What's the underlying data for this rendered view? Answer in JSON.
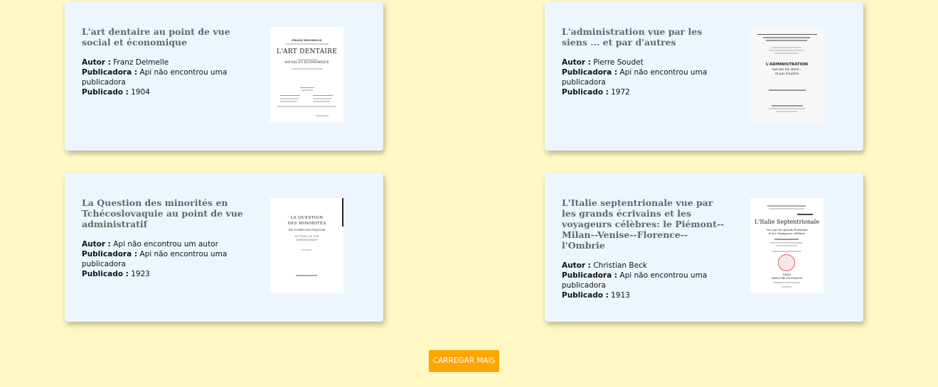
{
  "labels": {
    "author": "Autor :",
    "publisher": "Publicadora :",
    "published": "Publicado :"
  },
  "books": [
    {
      "title": "L'art dentaire au point de vue social et économique",
      "author": "Franz Delmelle",
      "publisher": "Api não encontrou uma publicadora",
      "published": "1904",
      "cover_text": [
        "FRANZ DELMELLE",
        "L'ART DENTAIRE",
        "SOCIAL ET ÉCONOMIQUE"
      ]
    },
    {
      "title": "L'administration vue par les siens ... et par d'autres",
      "author": "Pierre Soudet",
      "publisher": "Api não encontrou uma publicadora",
      "published": "1972",
      "cover_text": [
        "L'ADMINISTRATION",
        "vue par les siens...",
        "et par d'autres"
      ]
    },
    {
      "title": "La Question des minorités en Tchécoslovaquie au point de vue administratif",
      "author": "Api não encontrou um autor",
      "publisher": "Api não encontrou uma publicadora",
      "published": "1923",
      "cover_text": [
        "LA QUESTION",
        "DES MINORITÉS",
        "EN TCHÉCOSLOVAQUIE",
        "AU POINT DE VUE",
        "ADMINISTRATIF"
      ]
    },
    {
      "title": "L'Italie septentrionale vue par les grands écrivains et les voyageurs célèbres: le Piémont--Milan--Venise--Florence--l'Ombrie",
      "author": "Christian Beck",
      "publisher": "Api não encontrou uma publicadora",
      "published": "1913",
      "cover_text": [
        "L'Italie  Septentrionale",
        "Vue par les grands Écrivains",
        "et les Voyageurs célèbres",
        "PARIS",
        "MERCURE DE FRANCE"
      ]
    }
  ],
  "load_more_label": "CARREGAR MAIS",
  "colors": {
    "background": "#fff8c4",
    "card": "#edf6ff",
    "button": "#ffa500"
  }
}
